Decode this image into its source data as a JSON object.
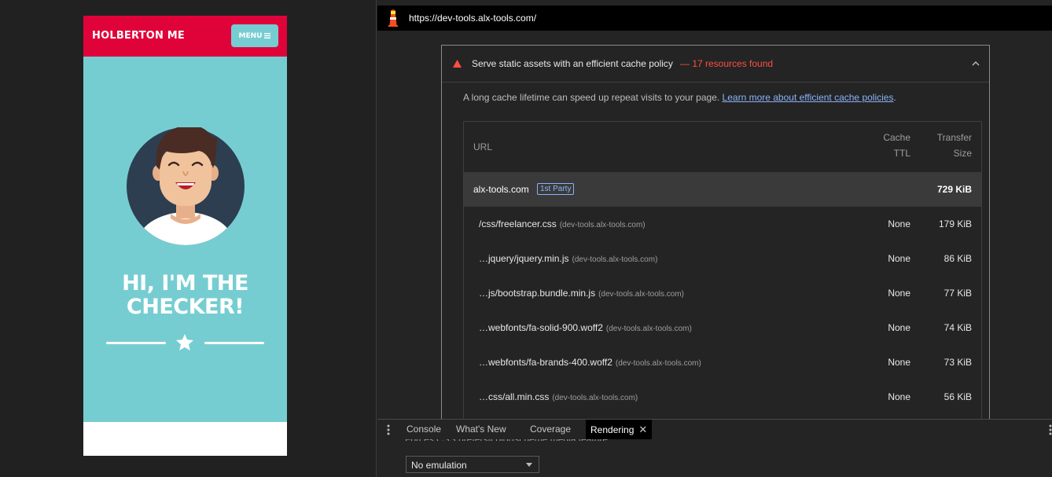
{
  "preview": {
    "brand": "HOLBERTON ME",
    "menu_label": "MENU",
    "hero_line1": "HI, I'M THE",
    "hero_line2": "CHECKER!",
    "colors": {
      "nav": "#e0033a",
      "masthead": "#76cdd1",
      "avatar_bg": "#2c3e50"
    },
    "icons": {
      "menu": "hamburger-icon",
      "divider": "star-icon",
      "avatar": "avatar-illustration"
    }
  },
  "devtools": {
    "page_url": "https://dev-tools.alx-tools.com/",
    "audit": {
      "title": "Serve static assets with an efficient cache policy",
      "display_value": "— 17 resources found",
      "description": "A long cache lifetime can speed up repeat visits to your page.",
      "learn_more": "Learn more about efficient cache policies",
      "description_end": ".",
      "status_color": "#ff4e42",
      "table": {
        "headers": {
          "url": "URL",
          "ttl_line1": "Cache",
          "ttl_line2": "TTL",
          "size_line1": "Transfer",
          "size_line2": "Size"
        },
        "group": {
          "name": "alx-tools.com",
          "badge": "1st Party",
          "size": "729 KiB"
        },
        "rows": [
          {
            "url": "/css/freelancer.css",
            "origin": "(dev-tools.alx-tools.com)",
            "ttl": "None",
            "size": "179 KiB"
          },
          {
            "url": "…jquery/jquery.min.js",
            "origin": "(dev-tools.alx-tools.com)",
            "ttl": "None",
            "size": "86 KiB"
          },
          {
            "url": "…js/bootstrap.bundle.min.js",
            "origin": "(dev-tools.alx-tools.com)",
            "ttl": "None",
            "size": "77 KiB"
          },
          {
            "url": "…webfonts/fa-solid-900.woff2",
            "origin": "(dev-tools.alx-tools.com)",
            "ttl": "None",
            "size": "74 KiB"
          },
          {
            "url": "…webfonts/fa-brands-400.woff2",
            "origin": "(dev-tools.alx-tools.com)",
            "ttl": "None",
            "size": "73 KiB"
          },
          {
            "url": "…css/all.min.css",
            "origin": "(dev-tools.alx-tools.com)",
            "ttl": "None",
            "size": "56 KiB"
          }
        ]
      }
    },
    "drawer": {
      "tabs": [
        "Console",
        "What's New",
        "Coverage",
        "Rendering"
      ],
      "active_tab": "Rendering",
      "caption": "Forces CSS prefers-color-scheme media feature",
      "select_value": "No emulation"
    }
  }
}
